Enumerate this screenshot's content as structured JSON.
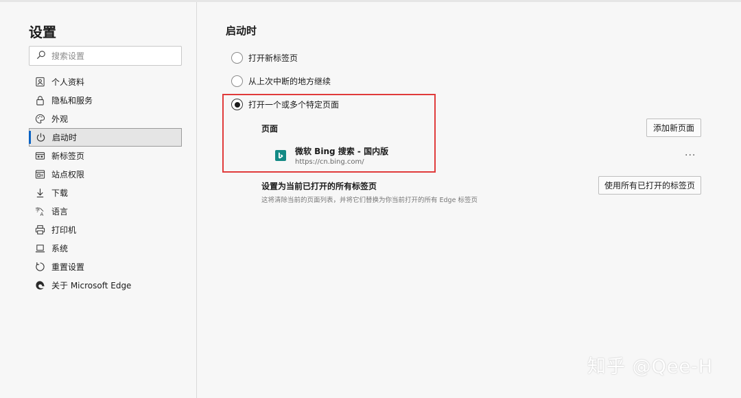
{
  "sidebar": {
    "title": "设置",
    "search_placeholder": "搜索设置",
    "items": [
      {
        "label": "个人资料",
        "icon": "profile-icon"
      },
      {
        "label": "隐私和服务",
        "icon": "lock-icon"
      },
      {
        "label": "外观",
        "icon": "palette-icon"
      },
      {
        "label": "启动时",
        "icon": "power-icon",
        "active": true
      },
      {
        "label": "新标签页",
        "icon": "new-tab-icon"
      },
      {
        "label": "站点权限",
        "icon": "site-permissions-icon"
      },
      {
        "label": "下载",
        "icon": "download-icon"
      },
      {
        "label": "语言",
        "icon": "language-icon"
      },
      {
        "label": "打印机",
        "icon": "printer-icon"
      },
      {
        "label": "系统",
        "icon": "laptop-icon"
      },
      {
        "label": "重置设置",
        "icon": "reset-icon"
      },
      {
        "label": "关于 Microsoft Edge",
        "icon": "edge-icon"
      }
    ]
  },
  "main": {
    "section_title": "启动时",
    "options": [
      {
        "label": "打开新标签页",
        "checked": false
      },
      {
        "label": "从上次中断的地方继续",
        "checked": false
      },
      {
        "label": "打开一个或多个特定页面",
        "checked": true
      }
    ],
    "pages_label": "页面",
    "add_page_button": "添加新页面",
    "page_entry": {
      "name": "微软 Bing 搜索 - 国内版",
      "url": "https://cn.bing.com/",
      "more": "···"
    },
    "set_all": {
      "title": "设置为当前已打开的所有标签页",
      "description": "这将清除当前的页面列表，并将它们替换为你当前打开的所有 Edge 标签页",
      "button": "使用所有已打开的标签页"
    }
  },
  "watermark": "知乎 @Qee-H",
  "colors": {
    "accent": "#0b63c4",
    "highlight_border": "#e03a3a",
    "bing": "#138a85"
  }
}
